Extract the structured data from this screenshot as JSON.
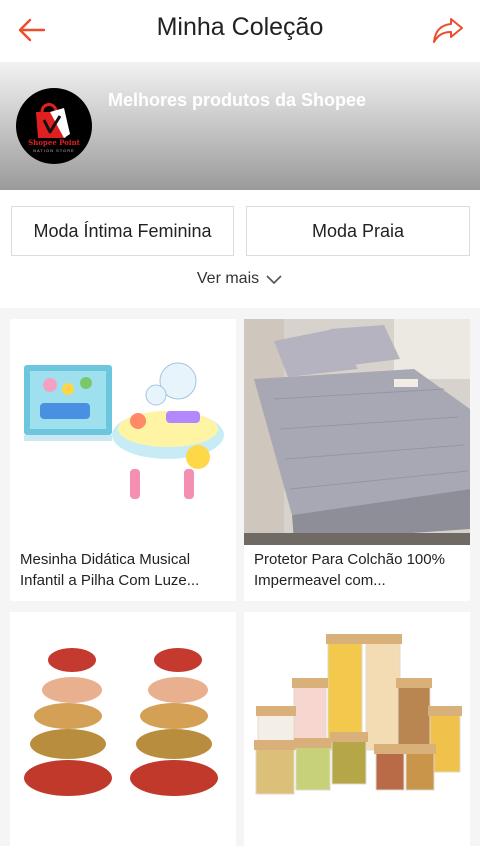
{
  "header": {
    "title": "Minha Coleção",
    "back_icon": "arrow-left-icon",
    "share_icon": "share-icon",
    "accent_color": "#ee4d2d"
  },
  "banner": {
    "title": "Melhores produtos da Shopee",
    "logo_text": "Shopee Point",
    "logo_subtext": "NATION STORE"
  },
  "categories": {
    "items": [
      {
        "label": "Moda Íntima Feminina"
      },
      {
        "label": "Moda Praia"
      }
    ],
    "more_label": "Ver mais"
  },
  "products": [
    {
      "name": "Mesinha Didática Musical Infantil a Pilha Com Luze..."
    },
    {
      "name": "Protetor Para Colchão 100% Impermeavel com..."
    },
    {
      "name": ""
    },
    {
      "name": ""
    }
  ]
}
